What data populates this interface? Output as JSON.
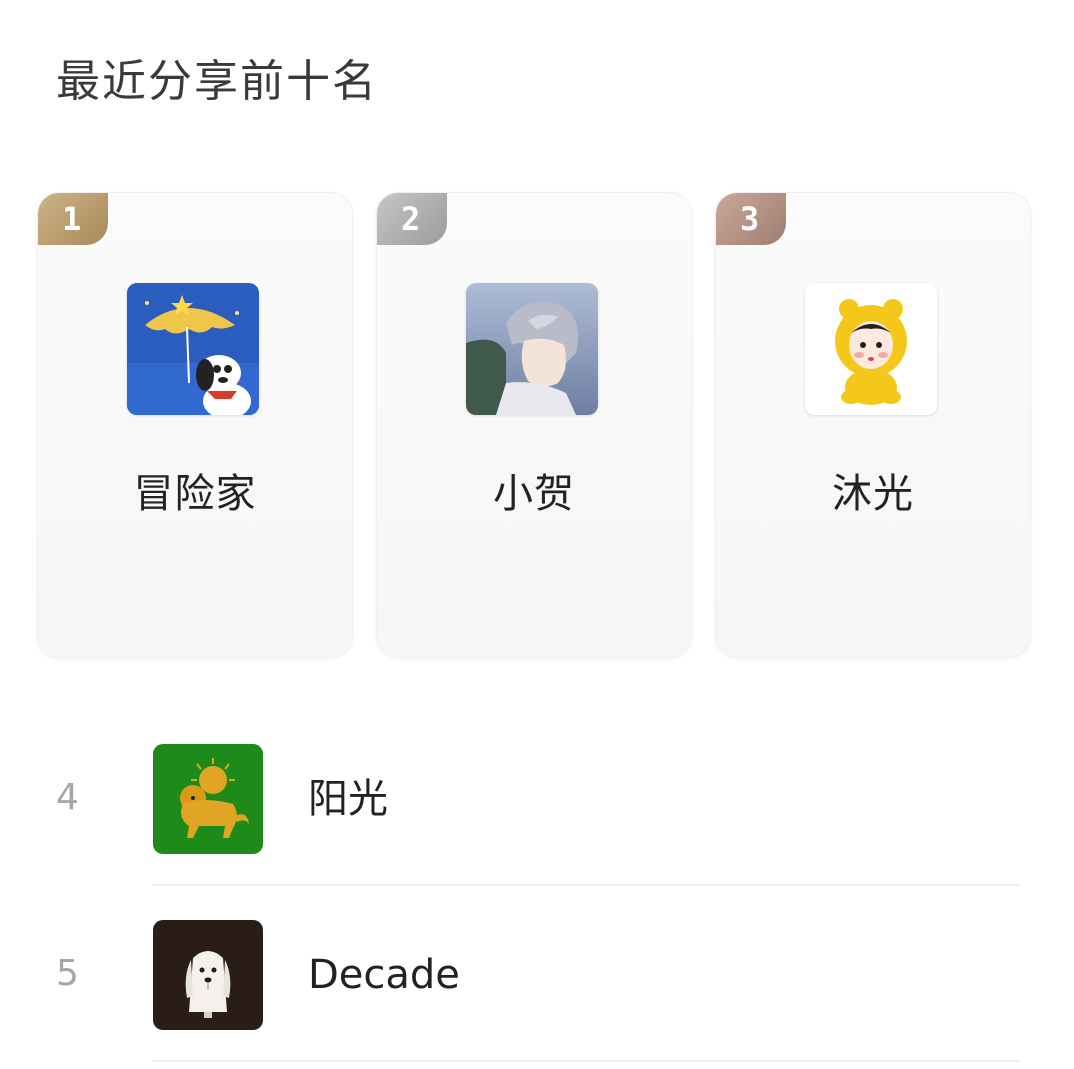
{
  "section": {
    "title": "最近分享前十名"
  },
  "top_three": [
    {
      "rank": "1",
      "name": "冒险家",
      "avatar_icon": "umbrella-dog-avatar-icon",
      "badge_color": "#b8996a"
    },
    {
      "rank": "2",
      "name": "小贺",
      "avatar_icon": "anime-boy-avatar-icon",
      "badge_color": "#aaaaaa"
    },
    {
      "rank": "3",
      "name": "沐光",
      "avatar_icon": "yellow-bear-baby-avatar-icon",
      "badge_color": "#ad8b7d"
    }
  ],
  "list": [
    {
      "rank": "4",
      "name": "阳光",
      "avatar_icon": "lion-sun-avatar-icon"
    },
    {
      "rank": "5",
      "name": "Decade",
      "avatar_icon": "dog-dark-avatar-icon"
    }
  ]
}
